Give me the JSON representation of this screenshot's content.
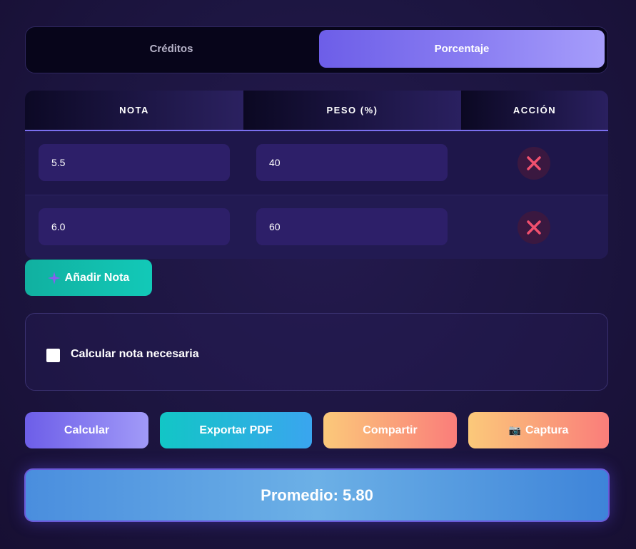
{
  "mode_switch": {
    "tabs": [
      {
        "label": "Créditos",
        "active": false
      },
      {
        "label": "Porcentaje",
        "active": true
      }
    ]
  },
  "table": {
    "headers": [
      "NOTA",
      "PESO (%)",
      "ACCIÓN"
    ],
    "rows": [
      {
        "nota": "5.5",
        "peso": "40",
        "action_icon": "close-icon"
      },
      {
        "nota": "6.0",
        "peso": "60",
        "action_icon": "close-icon"
      }
    ]
  },
  "add_button": {
    "label": "Añadir Nota",
    "icon": "sparkle-icon"
  },
  "options": {
    "checkbox_label": "Calcular nota necesaria",
    "checked": false
  },
  "actions": {
    "calc": "Calcular",
    "pdf": "Exportar PDF",
    "share": "Compartir",
    "capture": "Captura",
    "capture_icon": "camera-icon"
  },
  "result": {
    "text": "Promedio: 5.80"
  },
  "colors": {
    "accent": "#7b6ff0",
    "delete": "#f0506e",
    "add": "#12c0b0",
    "background": "#1c1540"
  }
}
